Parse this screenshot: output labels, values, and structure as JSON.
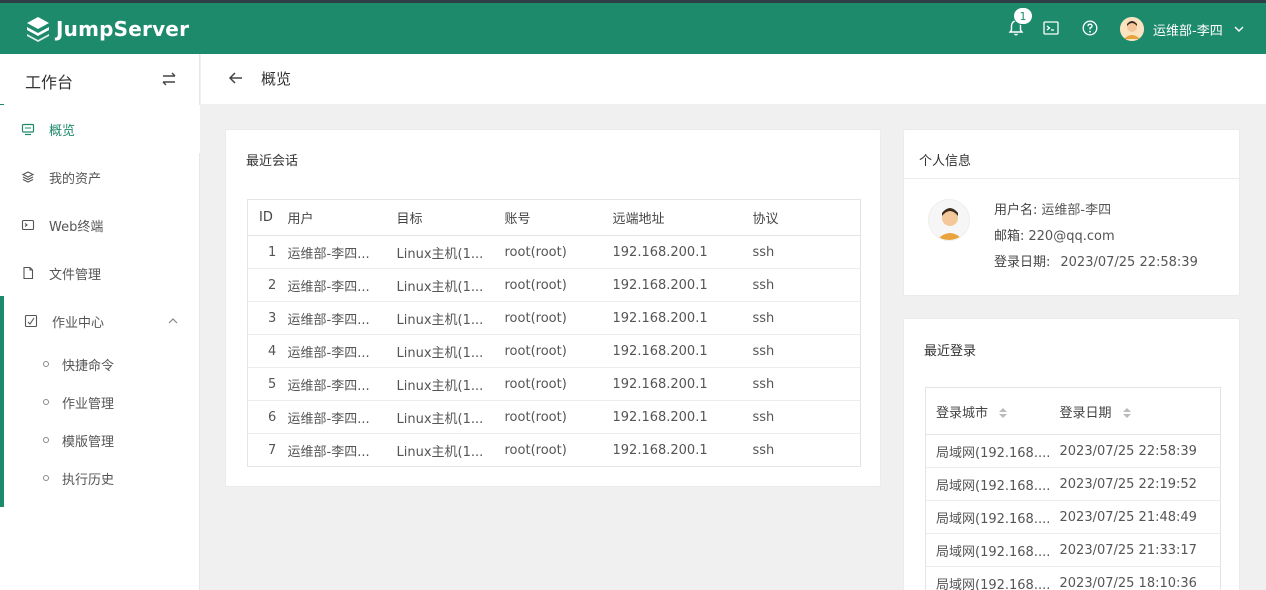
{
  "brand": {
    "name": "JumpServer"
  },
  "header": {
    "notification_count": "1",
    "user_name": "运维部-李四"
  },
  "sidebar": {
    "title": "工作台",
    "items": [
      {
        "label": "概览",
        "icon": "monitor-icon",
        "active": true
      },
      {
        "label": "我的资产",
        "icon": "layers-icon"
      },
      {
        "label": "Web终端",
        "icon": "terminal-icon"
      },
      {
        "label": "文件管理",
        "icon": "file-icon"
      },
      {
        "label": "作业中心",
        "icon": "ops-icon",
        "expanded": true
      }
    ],
    "sub_items": [
      {
        "label": "快捷命令"
      },
      {
        "label": "作业管理"
      },
      {
        "label": "模版管理"
      },
      {
        "label": "执行历史"
      }
    ]
  },
  "page": {
    "title": "概览"
  },
  "recent_sessions": {
    "title": "最近会话",
    "columns": [
      "ID",
      "用户",
      "目标",
      "账号",
      "远端地址",
      "协议"
    ],
    "rows": [
      [
        "1",
        "运维部-李四...",
        "Linux主机(1...",
        "root(root)",
        "192.168.200.1",
        "ssh"
      ],
      [
        "2",
        "运维部-李四...",
        "Linux主机(1...",
        "root(root)",
        "192.168.200.1",
        "ssh"
      ],
      [
        "3",
        "运维部-李四...",
        "Linux主机(1...",
        "root(root)",
        "192.168.200.1",
        "ssh"
      ],
      [
        "4",
        "运维部-李四...",
        "Linux主机(1...",
        "root(root)",
        "192.168.200.1",
        "ssh"
      ],
      [
        "5",
        "运维部-李四...",
        "Linux主机(1...",
        "root(root)",
        "192.168.200.1",
        "ssh"
      ],
      [
        "6",
        "运维部-李四...",
        "Linux主机(1...",
        "root(root)",
        "192.168.200.1",
        "ssh"
      ],
      [
        "7",
        "运维部-李四...",
        "Linux主机(1...",
        "root(root)",
        "192.168.200.1",
        "ssh"
      ]
    ]
  },
  "profile": {
    "title": "个人信息",
    "username_label": "用户名:",
    "username": "运维部-李四",
    "email_label": "邮箱:",
    "email": "220@qq.com",
    "login_date_label": "登录日期:",
    "login_date": "2023/07/25 22:58:39"
  },
  "recent_logins": {
    "title": "最近登录",
    "columns": [
      "登录城市",
      "登录日期"
    ],
    "rows": [
      [
        "局域网(192.168....",
        "2023/07/25 22:58:39"
      ],
      [
        "局域网(192.168....",
        "2023/07/25 22:19:52"
      ],
      [
        "局域网(192.168....",
        "2023/07/25 21:48:49"
      ],
      [
        "局域网(192.168....",
        "2023/07/25 21:33:17"
      ],
      [
        "局域网(192.168....",
        "2023/07/25 18:10:36"
      ]
    ]
  },
  "colors": {
    "brand": "#1d8a6b",
    "header_top": "#2f3e46"
  }
}
